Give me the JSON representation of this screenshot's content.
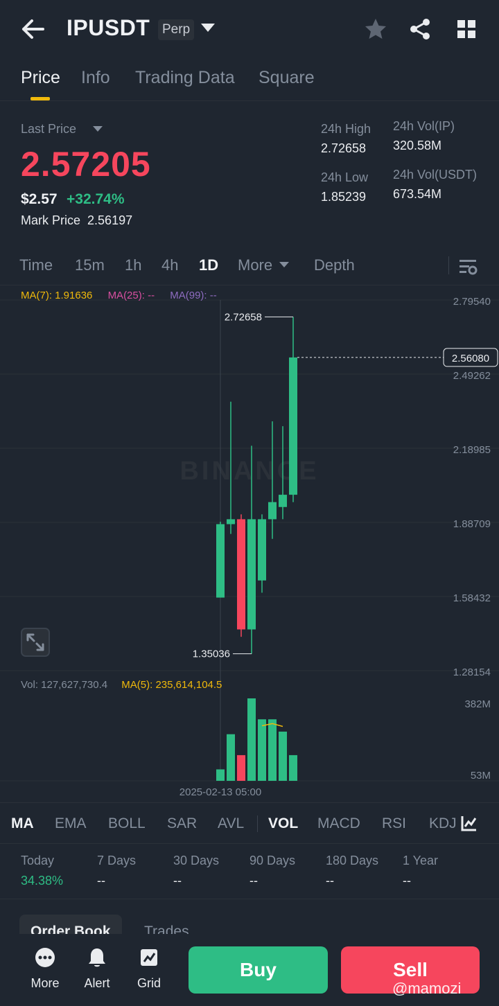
{
  "header": {
    "symbol": "IPUSDT",
    "contract_type": "Perp",
    "icons": [
      "back-arrow-icon",
      "caret-down-icon",
      "star-icon",
      "share-icon",
      "grid-icon"
    ]
  },
  "tabs": [
    "Price",
    "Info",
    "Trading Data",
    "Square"
  ],
  "active_tab": "Price",
  "price": {
    "last_price_label": "Last Price",
    "last_price": "2.57205",
    "usd_price": "$2.57",
    "change_pct": "+32.74%",
    "mark_price_label": "Mark Price",
    "mark_price": "2.56197",
    "high_label": "24h High",
    "high": "2.72658",
    "low_label": "24h Low",
    "low": "1.85239",
    "vol_base_label": "24h Vol(IP)",
    "vol_base": "320.58M",
    "vol_quote_label": "24h Vol(USDT)",
    "vol_quote": "673.54M"
  },
  "intervals": [
    "Time",
    "15m",
    "1h",
    "4h",
    "1D",
    "More",
    "Depth"
  ],
  "active_interval": "1D",
  "ma": {
    "ma7": "MA(7): 1.91636",
    "ma25": "MA(25): --",
    "ma99": "MA(99): --"
  },
  "colors": {
    "up": "#2ebd85",
    "down": "#f6465d",
    "ma7": "#f0b90b",
    "ma25": "#d84fa0",
    "ma99": "#8e6cc0",
    "accent": "#f0b90b"
  },
  "watermark_brand": "BINANCE",
  "volume": {
    "label": "Vol: 127,627,730.4",
    "ma5": "MA(5): 235,614,104.5"
  },
  "chart_data": {
    "type": "candlestick",
    "y_axis_ticks": [
      "2.79540",
      "2.49262",
      "2.18985",
      "1.88709",
      "1.58432",
      "1.28154"
    ],
    "ylim": [
      1.28154,
      2.7954
    ],
    "current_price_tag": "2.56080",
    "max_label": "2.72658",
    "min_label": "1.35036",
    "crosshair_date": "2025-02-13 05:00",
    "candles": [
      {
        "open": 1.58,
        "high": 1.89,
        "low": 1.58,
        "close": 1.88
      },
      {
        "open": 1.88,
        "high": 2.38,
        "low": 1.84,
        "close": 1.9
      },
      {
        "open": 1.9,
        "high": 1.92,
        "low": 1.42,
        "close": 1.45
      },
      {
        "open": 1.45,
        "high": 2.2,
        "low": 1.35036,
        "close": 1.9
      },
      {
        "open": 1.65,
        "high": 1.92,
        "low": 1.6,
        "close": 1.9
      },
      {
        "open": 1.9,
        "high": 2.3,
        "low": 1.82,
        "close": 1.97
      },
      {
        "open": 1.95,
        "high": 2.28,
        "low": 1.9,
        "close": 2.0
      },
      {
        "open": 2.0,
        "high": 2.72658,
        "low": 1.97,
        "close": 2.5608
      }
    ],
    "volume_ticks": [
      "382M",
      "53M"
    ],
    "volume_max": 382,
    "volume_values": [
      53,
      216,
      119,
      382,
      285,
      285,
      228,
      119
    ],
    "volume_ma5": [
      null,
      null,
      null,
      null,
      255,
      265,
      252
    ]
  },
  "indicators": [
    "MA",
    "EMA",
    "BOLL",
    "SAR",
    "AVL",
    "VOL",
    "MACD",
    "RSI",
    "KDJ"
  ],
  "active_main_indicator": "MA",
  "active_sub_indicator": "VOL",
  "performance": [
    {
      "label": "Today",
      "value": "34.38%"
    },
    {
      "label": "7 Days",
      "value": "--"
    },
    {
      "label": "30 Days",
      "value": "--"
    },
    {
      "label": "90 Days",
      "value": "--"
    },
    {
      "label": "180 Days",
      "value": "--"
    },
    {
      "label": "1 Year",
      "value": "--"
    }
  ],
  "order_tabs": [
    "Order Book",
    "Trades"
  ],
  "bottom_nav": {
    "more": "More",
    "alert": "Alert",
    "grid": "Grid",
    "buy": "Buy",
    "sell": "Sell"
  },
  "watermark": "@mamozi"
}
